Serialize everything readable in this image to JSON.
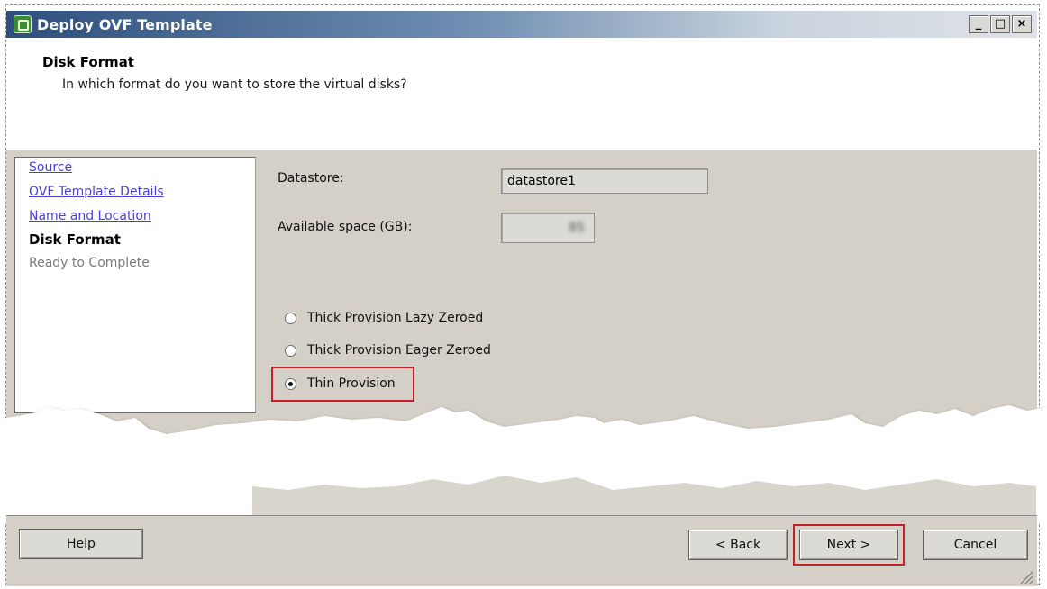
{
  "window": {
    "title": "Deploy OVF Template",
    "controls": [
      "_",
      "□",
      "×"
    ]
  },
  "header": {
    "title": "Disk Format",
    "subtitle": "In which format do you want to store the virtual disks?"
  },
  "steps": [
    {
      "label": "Source",
      "state": "link"
    },
    {
      "label": "OVF Template Details",
      "state": "link"
    },
    {
      "label": "Name and Location",
      "state": "link"
    },
    {
      "label": "Disk Format",
      "state": "current"
    },
    {
      "label": "Ready to Complete",
      "state": "pending"
    }
  ],
  "form": {
    "datastore_label": "Datastore:",
    "datastore_value": "datastore1",
    "space_label": "Available space (GB):",
    "space_value": "85"
  },
  "disk_options": [
    {
      "label": "Thick Provision Lazy Zeroed",
      "checked": false
    },
    {
      "label": "Thick Provision Eager Zeroed",
      "checked": false
    },
    {
      "label": "Thin Provision",
      "checked": true
    }
  ],
  "buttons": {
    "help": "Help",
    "back": "< Back",
    "next": "Next >",
    "cancel": "Cancel"
  },
  "colors": {
    "highlight": "#c4202a",
    "link": "#4a3fd6",
    "panel": "#d4d0c8"
  }
}
